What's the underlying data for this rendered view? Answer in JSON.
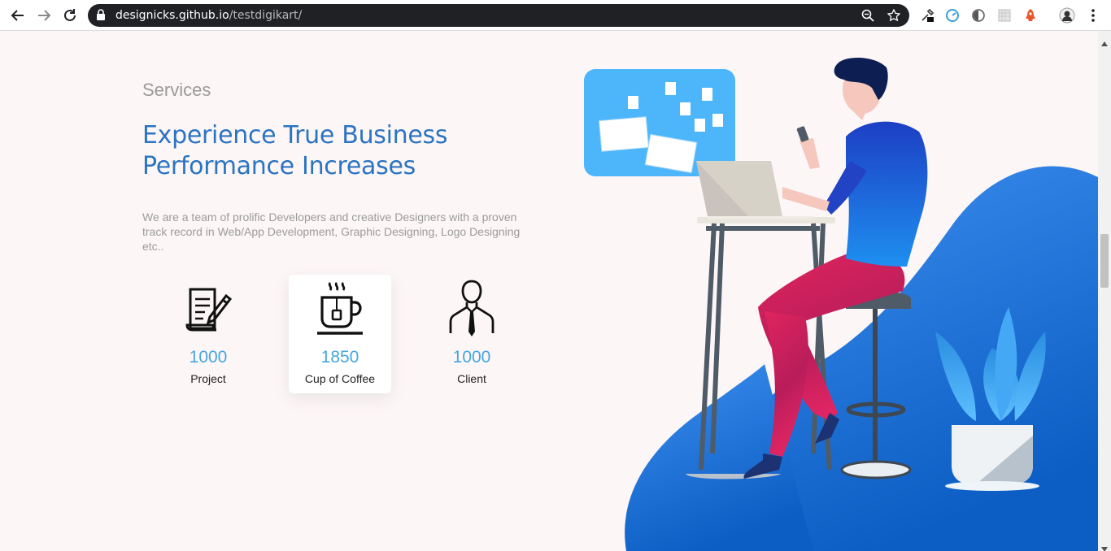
{
  "browser": {
    "url_domain": "designicks.github.io",
    "url_path": "/testdigikart/"
  },
  "services": {
    "eyebrow": "Services",
    "headline_line1": "Experience True Business",
    "headline_line2": "Performance Increases",
    "description": "We are a team of prolific Developers and creative Designers with a proven track record in Web/App Development, Graphic Designing, Logo Designing etc..",
    "stats": [
      {
        "icon": "document-pen-icon",
        "value": "1000",
        "label": "Project"
      },
      {
        "icon": "coffee-cup-icon",
        "value": "1850",
        "label": "Cup of Coffee"
      },
      {
        "icon": "client-person-icon",
        "value": "1000",
        "label": "Client"
      }
    ]
  },
  "colors": {
    "accent": "#2b74c2",
    "stat_number": "#46a6e2",
    "background": "#fdf6f6"
  }
}
